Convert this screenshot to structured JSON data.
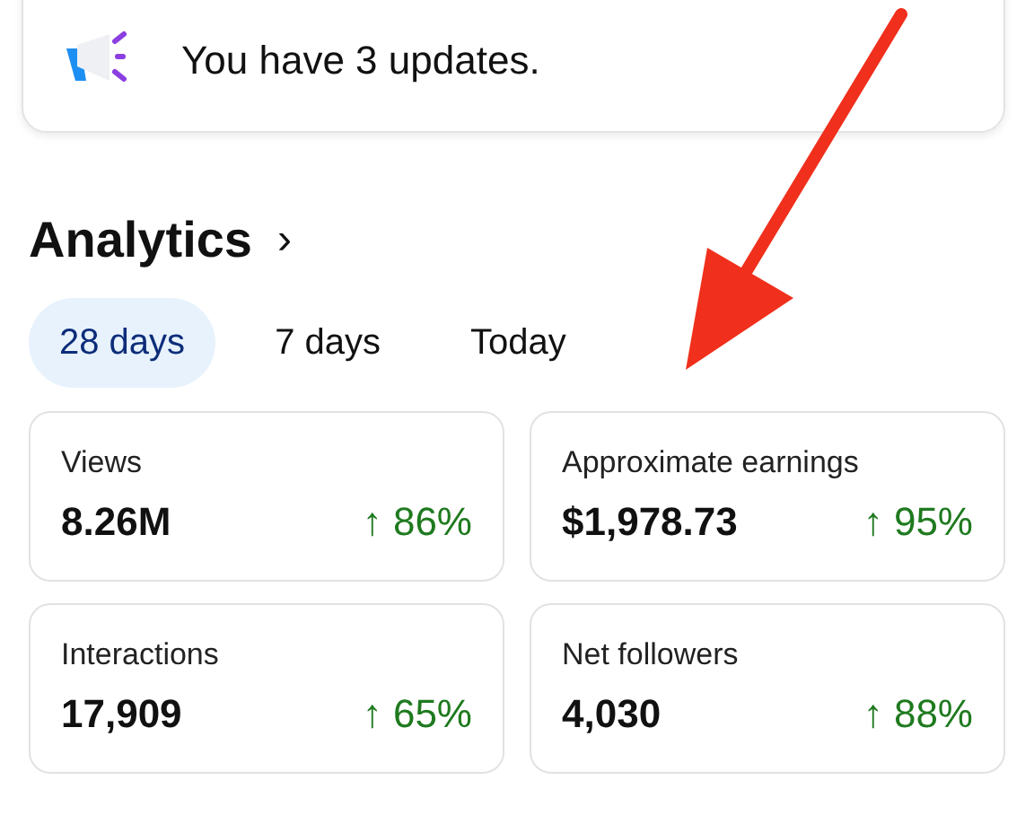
{
  "update_banner": {
    "text": "You have 3 updates."
  },
  "analytics": {
    "title": "Analytics",
    "chevron": "›"
  },
  "tabs": [
    {
      "label": "28 days",
      "selected": true
    },
    {
      "label": "7 days",
      "selected": false
    },
    {
      "label": "Today",
      "selected": false
    }
  ],
  "metrics": [
    {
      "label": "Views",
      "value": "8.26M",
      "change": "↑ 86%"
    },
    {
      "label": "Approximate earnings",
      "value": "$1,978.73",
      "change": "↑ 95%"
    },
    {
      "label": "Interactions",
      "value": "17,909",
      "change": "↑ 65%"
    },
    {
      "label": "Net followers",
      "value": "4,030",
      "change": "↑ 88%"
    }
  ],
  "annotation": {
    "kind": "arrow"
  }
}
